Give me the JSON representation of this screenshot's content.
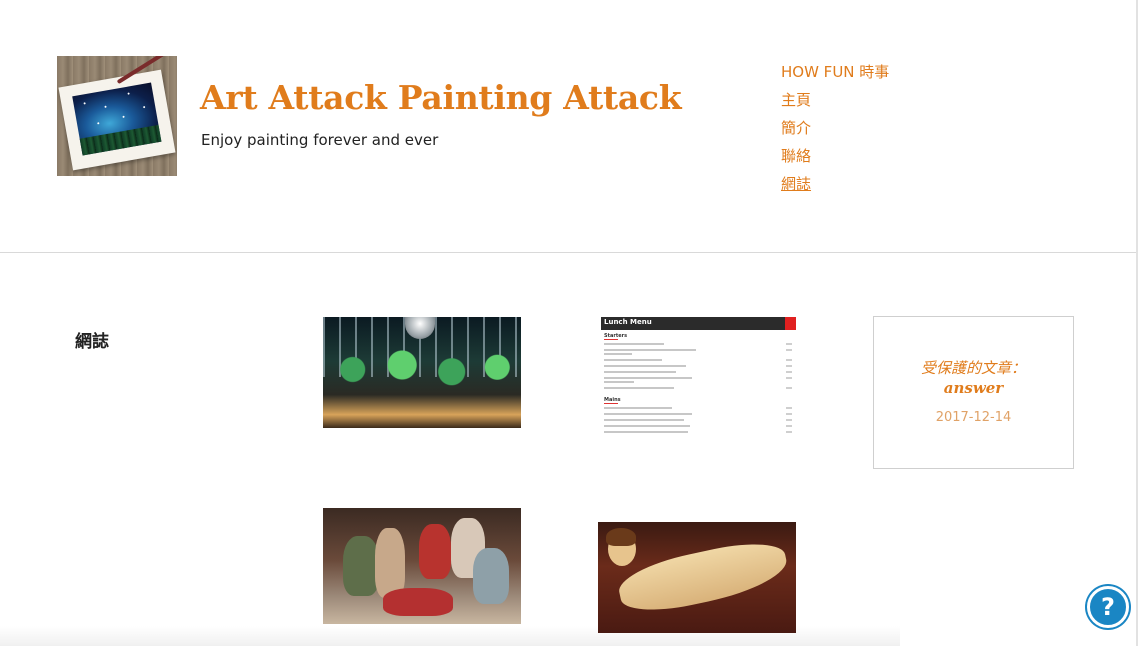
{
  "site": {
    "title": "Art Attack Painting Attack",
    "tagline": "Enjoy painting forever and ever"
  },
  "nav": {
    "items": [
      {
        "label": "HOW FUN 時事"
      },
      {
        "label": "主頁"
      },
      {
        "label": "簡介"
      },
      {
        "label": "聯絡"
      },
      {
        "label": "網誌",
        "current": true
      }
    ]
  },
  "page": {
    "heading": "網誌"
  },
  "posts": {
    "menu_image": {
      "title": "Lunch Menu",
      "section_starters": "Starters",
      "section_mains": "Mains"
    },
    "protected": {
      "label": "受保護的文章：",
      "name": "answer",
      "date": "2017-12-14"
    }
  },
  "colors": {
    "accent": "#e07c1c",
    "date": "#e0a267",
    "help": "#1a86c4"
  },
  "icons": {
    "help": "question-circle-icon"
  }
}
